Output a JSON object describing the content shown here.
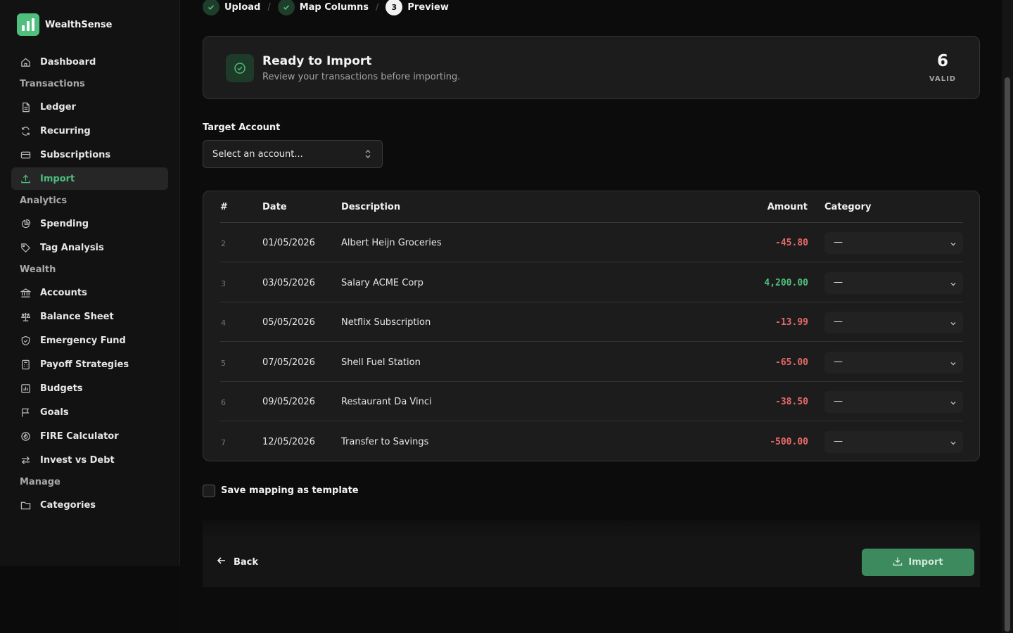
{
  "app": {
    "name": "WealthSense"
  },
  "sidebar": {
    "items": [
      {
        "label": "Dashboard",
        "icon": "home-icon"
      },
      {
        "label": "Ledger",
        "icon": "document-icon"
      },
      {
        "label": "Recurring",
        "icon": "refresh-icon"
      },
      {
        "label": "Subscriptions",
        "icon": "credit-card-icon"
      },
      {
        "label": "Import",
        "icon": "upload-icon",
        "active": true
      },
      {
        "label": "Spending",
        "icon": "pie-chart-icon"
      },
      {
        "label": "Tag Analysis",
        "icon": "tag-icon"
      },
      {
        "label": "Accounts",
        "icon": "bank-icon"
      },
      {
        "label": "Balance Sheet",
        "icon": "scale-icon"
      },
      {
        "label": "Emergency Fund",
        "icon": "shield-icon"
      },
      {
        "label": "Payoff Strategies",
        "icon": "calculator-icon"
      },
      {
        "label": "Budgets",
        "icon": "bar-chart-icon"
      },
      {
        "label": "Goals",
        "icon": "flag-icon"
      },
      {
        "label": "FIRE Calculator",
        "icon": "flame-icon"
      },
      {
        "label": "Invest vs Debt",
        "icon": "arrows-icon"
      },
      {
        "label": "Categories",
        "icon": "folder-icon"
      }
    ],
    "sections": [
      "Transactions",
      "Analytics",
      "Wealth",
      "Manage"
    ]
  },
  "steps": [
    {
      "label": "Upload",
      "state": "done"
    },
    {
      "label": "Map Columns",
      "state": "done"
    },
    {
      "label": "Preview",
      "number": "3",
      "state": "current"
    }
  ],
  "ready": {
    "title": "Ready to Import",
    "subtitle": "Review your transactions before importing.",
    "count": "6",
    "count_label": "VALID"
  },
  "target_account": {
    "label": "Target Account",
    "placeholder": "Select an account..."
  },
  "table": {
    "headers": {
      "num": "#",
      "date": "Date",
      "description": "Description",
      "amount": "Amount",
      "category": "Category"
    },
    "rows": [
      {
        "num": "2",
        "date": "01/05/2026",
        "description": "Albert Heijn Groceries",
        "amount": "-45.80",
        "sign": "neg",
        "category": "—"
      },
      {
        "num": "3",
        "date": "03/05/2026",
        "description": "Salary ACME Corp",
        "amount": "4,200.00",
        "sign": "pos",
        "category": "—"
      },
      {
        "num": "4",
        "date": "05/05/2026",
        "description": "Netflix Subscription",
        "amount": "-13.99",
        "sign": "neg",
        "category": "—"
      },
      {
        "num": "5",
        "date": "07/05/2026",
        "description": "Shell Fuel Station",
        "amount": "-65.00",
        "sign": "neg",
        "category": "—"
      },
      {
        "num": "6",
        "date": "09/05/2026",
        "description": "Restaurant Da Vinci",
        "amount": "-38.50",
        "sign": "neg",
        "category": "—"
      },
      {
        "num": "7",
        "date": "12/05/2026",
        "description": "Transfer to Savings",
        "amount": "-500.00",
        "sign": "neg",
        "category": "—"
      }
    ]
  },
  "save_template": {
    "label": "Save mapping as template",
    "checked": false
  },
  "footer": {
    "back_label": "Back",
    "import_label": "Import"
  },
  "colors": {
    "accent": "#4fbf7d",
    "negative": "#e86a6a",
    "button": "#3c8a5d"
  }
}
